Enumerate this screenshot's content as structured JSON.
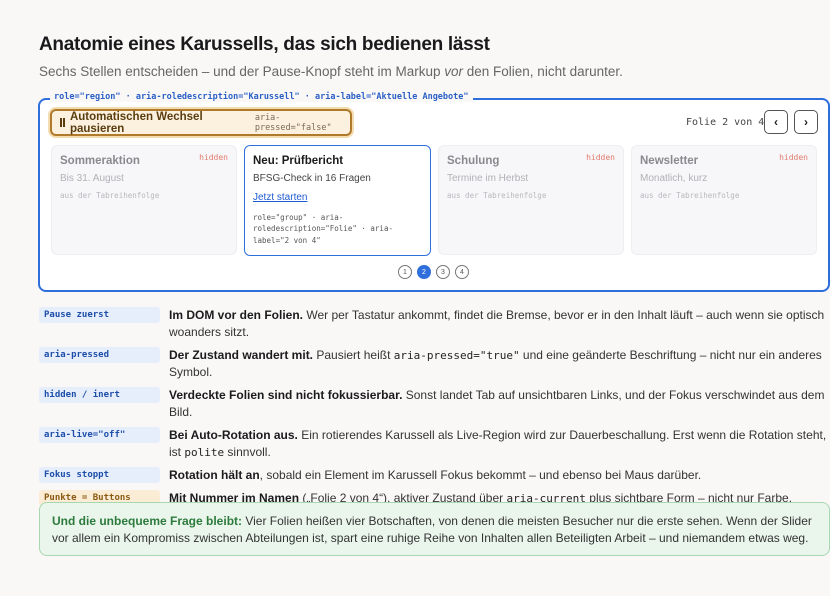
{
  "header": {
    "title": "Anatomie eines Karussells, das sich bedienen lässt",
    "subtitle_before": "Sechs Stellen entscheiden – und der Pause-Knopf steht im Markup ",
    "subtitle_em": "vor",
    "subtitle_after": " den Folien, nicht darunter."
  },
  "region": {
    "label": "role=\"region\" · aria-roledescription=\"Karussell\" · aria-label=\"Aktuelle Angebote\"",
    "pause_label": "Automatischen Wechsel pausieren",
    "pause_attr": "aria-pressed=\"false\"",
    "slide_count": "Folie 2 von 4",
    "prev_label": "‹",
    "next_label": "›",
    "dots": [
      "1",
      "2",
      "3",
      "4"
    ],
    "active_dot": 2
  },
  "slides": [
    {
      "title": "Sommeraktion",
      "sub": "Bis 31. August",
      "tag": "hidden",
      "note": "aus der Tabreihenfolge"
    },
    {
      "title": "Neu: Prüfbericht",
      "sub": "BFSG-Check in 16 Fragen",
      "link": "Jetzt starten",
      "attrs": "role=\"group\" · aria-roledescription=\"Folie\" · aria-label=\"2 von 4\""
    },
    {
      "title": "Schulung",
      "sub": "Termine im Herbst",
      "tag": "hidden",
      "note": "aus der Tabreihenfolge"
    },
    {
      "title": "Newsletter",
      "sub": "Monatlich, kurz",
      "tag": "hidden",
      "note": "aus der Tabreihenfolge"
    }
  ],
  "rows": [
    {
      "tag": "Pause zuerst",
      "bold": "Im DOM vor den Folien.",
      "text": " Wer per Tastatur ankommt, findet die Bremse, bevor er in den Inhalt läuft – auch wenn sie optisch woanders sitzt."
    },
    {
      "tag": "aria-pressed",
      "bold": "Der Zustand wandert mit.",
      "text1": " Pausiert heißt ",
      "code": "aria-pressed=\"true\"",
      "text2": " und eine geänderte Beschriftung – nicht nur ein anderes Symbol."
    },
    {
      "tag": "hidden / inert",
      "bold": "Verdeckte Folien sind nicht fokussierbar.",
      "text": " Sonst landet Tab auf unsichtbaren Links, und der Fokus verschwindet aus dem Bild."
    },
    {
      "tag": "aria-live=\"off\"",
      "bold": "Bei Auto-Rotation aus.",
      "text1": " Ein rotierendes Karussell als Live-Region wird zur Dauerbeschallung. Erst wenn die Rotation steht, ist ",
      "code": "polite",
      "text2": " sinnvoll."
    },
    {
      "tag": "Fokus stoppt",
      "bold": "Rotation hält an",
      "text": ", sobald ein Element im Karussell Fokus bekommt – und ebenso bei Maus darüber."
    },
    {
      "tag": "Punkte = Buttons",
      "bold": "Mit Nummer im Namen",
      "text1": " („Folie 2 von 4“), aktiver Zustand über ",
      "code": "aria-current",
      "text2": " plus sichtbare Form – nicht nur Farbe."
    }
  ],
  "note": {
    "bold": "Und die unbequeme Frage bleibt:",
    "text": " Vier Folien heißen vier Botschaften, von denen die meisten Besucher nur die erste sehen. Wenn der Slider vor allem ein Kompromiss zwischen Abteilungen ist, spart eine ruhige Reihe von Inhalten allen Beteiligten Arbeit – und niemandem etwas weg."
  }
}
